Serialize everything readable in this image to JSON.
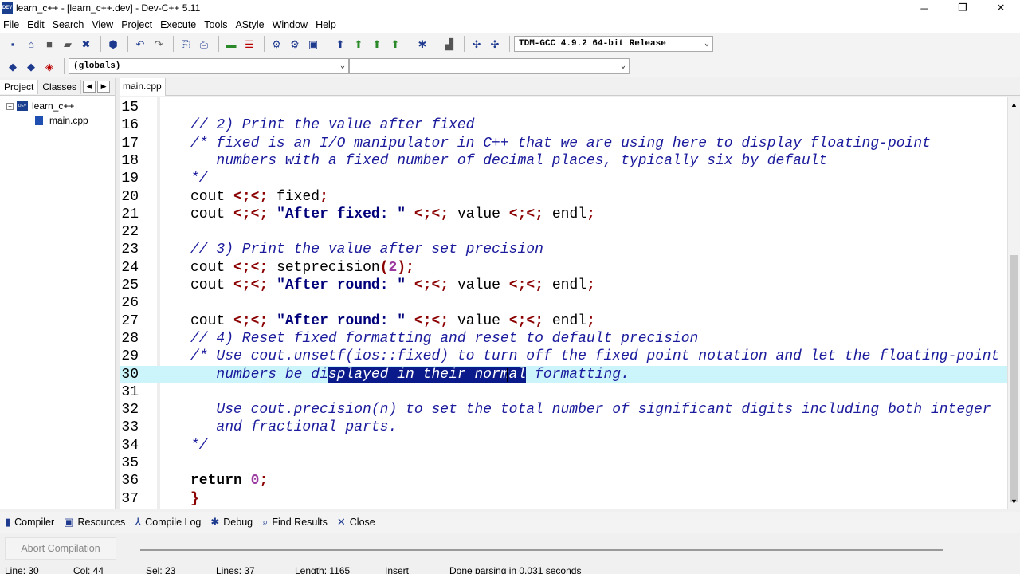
{
  "window": {
    "title": "learn_c++ - [learn_c++.dev] - Dev-C++ 5.11",
    "app_badge": "DEV",
    "minimize": "─",
    "maximize": "❐",
    "close": "✕"
  },
  "menu": [
    "File",
    "Edit",
    "Search",
    "View",
    "Project",
    "Execute",
    "Tools",
    "AStyle",
    "Window",
    "Help"
  ],
  "toolbar": {
    "compiler_select": "TDM-GCC 4.9.2 64-bit Release",
    "scope_select": "(globals)",
    "symbol_select": ""
  },
  "left_panel": {
    "tabs": [
      "Project",
      "Classes"
    ],
    "nav_prev": "◀",
    "nav_next": "▶",
    "tree": {
      "project": "learn_c++",
      "file": "main.cpp",
      "expander": "−"
    }
  },
  "editor": {
    "tab": "main.cpp",
    "current_line": 30,
    "lines": [
      {
        "n": "15",
        "t": ""
      },
      {
        "n": "16",
        "t": "// 2) Print the value after fixed"
      },
      {
        "n": "17",
        "t": "/* fixed is an I/O manipulator in C++ that we are using here to display floating-point"
      },
      {
        "n": "18",
        "t": "   numbers with a fixed number of decimal places, typically six by default"
      },
      {
        "n": "19",
        "t": "*/"
      },
      {
        "n": "20",
        "t": "cout << fixed;"
      },
      {
        "n": "21",
        "t": "cout << \"After fixed: \" << value << endl;"
      },
      {
        "n": "22",
        "t": ""
      },
      {
        "n": "23",
        "t": "// 3) Print the value after set precision"
      },
      {
        "n": "24",
        "t": "cout << setprecision(2);"
      },
      {
        "n": "25",
        "t": "cout << \"After round: \" << value << endl;"
      },
      {
        "n": "26",
        "t": ""
      },
      {
        "n": "27",
        "t": "cout << \"After round: \" << value << endl;"
      },
      {
        "n": "28",
        "t": "// 4) Reset fixed formatting and reset to default precision"
      },
      {
        "n": "29",
        "t": "/* Use cout.unsetf(ios::fixed) to turn off the fixed point notation and let the floating-point"
      },
      {
        "n": "30",
        "t": "   numbers be displayed in their normal formatting."
      },
      {
        "n": "31",
        "t": ""
      },
      {
        "n": "32",
        "t": "   Use cout.precision(n) to set the total number of significant digits including both integer"
      },
      {
        "n": "33",
        "t": "   and fractional parts."
      },
      {
        "n": "34",
        "t": "*/"
      },
      {
        "n": "35",
        "t": ""
      },
      {
        "n": "36",
        "t": "return 0;"
      },
      {
        "n": "37",
        "t": "}"
      }
    ],
    "selection": {
      "line": "30",
      "before": "   numbers be di",
      "selected": "splayed in their normal",
      "after": " formatting."
    }
  },
  "bottom_tabs": [
    {
      "label": "Compiler",
      "icon": "compiler-icon",
      "glyph": "▮"
    },
    {
      "label": "Resources",
      "icon": "resources-icon",
      "glyph": "▣"
    },
    {
      "label": "Compile Log",
      "icon": "compile-log-icon",
      "glyph": "⅄"
    },
    {
      "label": "Debug",
      "icon": "debug-icon",
      "glyph": "✱"
    },
    {
      "label": "Find Results",
      "icon": "find-results-icon",
      "glyph": "⌕"
    },
    {
      "label": "Close",
      "icon": "close-icon",
      "glyph": "✕"
    }
  ],
  "abort_button": "Abort Compilation",
  "status": {
    "line": "Line:  30",
    "col": "Col:  44",
    "sel": "Sel:  23",
    "lines": "Lines:  37",
    "length": "Length:  1165",
    "mode": "Insert",
    "message": "Done parsing in 0.031 seconds"
  }
}
